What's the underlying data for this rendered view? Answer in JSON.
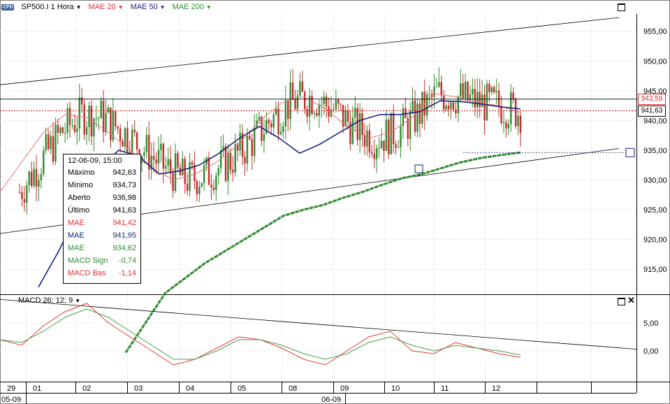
{
  "toolbar": {
    "badge": "CFD",
    "symbol": "SP500.I 1 Hora",
    "indicators": [
      {
        "label": "MAE 20",
        "color": "#e03030"
      },
      {
        "label": "MAE 50",
        "color": "#1a237e"
      },
      {
        "label": "MAE 200",
        "color": "#2e8b2e"
      }
    ]
  },
  "macd_panel": {
    "label": "MACD 26; 12; 9"
  },
  "info_box": {
    "timestamp": "12-06-09, 15:00",
    "rows": [
      {
        "label": "Máximo",
        "value": "942,63",
        "color": "#000000"
      },
      {
        "label": "Mínimo",
        "value": "934,73",
        "color": "#000000"
      },
      {
        "label": "Aberto",
        "value": "936,98",
        "color": "#000000"
      },
      {
        "label": "Último",
        "value": "941,63",
        "color": "#000000"
      },
      {
        "label": "MAE",
        "value": "941,42",
        "color": "#e03030"
      },
      {
        "label": "MAE",
        "value": "941,95",
        "color": "#1a237e"
      },
      {
        "label": "MAE",
        "value": "934,62",
        "color": "#2e8b2e"
      },
      {
        "label": "MACD Sign",
        "value": "-0,74",
        "color": "#2e8b2e"
      },
      {
        "label": "MACD Bas",
        "value": "-1,14",
        "color": "#e03030"
      }
    ]
  },
  "price_tags": [
    {
      "value": "943,59",
      "color": "#d32f2f"
    },
    {
      "value": "941,63",
      "color": "#000000"
    }
  ],
  "colors": {
    "candle_up": "#2e8b2e",
    "candle_down": "#c62828",
    "ma20": "#e57373",
    "ma50": "#1a237e",
    "ma200": "#2e8b2e",
    "macd_line": "#e53935",
    "signal_line": "#43a047",
    "grid": "#d0d0d0",
    "last_price_line": "#d32f2f"
  },
  "chart_data": [
    {
      "type": "candlestick",
      "title": "SP500.I 1 Hora",
      "y_axis_side": "right",
      "y_ticks": [
        "955,00",
        "950,00",
        "945,00",
        "940,00",
        "935,00",
        "930,00",
        "925,00",
        "920,00",
        "915,00"
      ],
      "y_values": [
        955,
        950,
        945,
        940,
        935,
        930,
        925,
        920,
        915
      ],
      "ylim": [
        910.8,
        957.9
      ],
      "x_ticks": [
        "29",
        "01",
        "02",
        "03",
        "04",
        "05",
        "08",
        "09",
        "10",
        "11",
        "12"
      ],
      "x_group_labels": [
        "05-09",
        "06-09"
      ],
      "last_price": 941.63,
      "last_close_line": 943.59,
      "series": [
        {
          "name": "MAE 20",
          "values": [
            928,
            933,
            938,
            941,
            940.5,
            938,
            935,
            932,
            930,
            931,
            933,
            936,
            940,
            943,
            944,
            942,
            939,
            937,
            938,
            940.5,
            944.5,
            944,
            943,
            942.5,
            941.4
          ]
        },
        {
          "name": "MAE 50",
          "values": [
            912,
            918,
            925,
            932,
            935,
            934,
            931,
            931.5,
            932.5,
            934.5,
            937,
            939,
            937,
            934.5,
            936,
            938,
            940,
            941,
            941,
            941.5,
            943.3,
            943.2,
            942.8,
            942.3,
            941.95
          ]
        },
        {
          "name": "MAE 200",
          "values": [
            901,
            906,
            911,
            913.5,
            916,
            918,
            920,
            922,
            924,
            925,
            925.8,
            927,
            928,
            929.2,
            930.3,
            931,
            932,
            933,
            933.7,
            934.2,
            934.62
          ]
        }
      ],
      "trendlines": [
        {
          "from": [
            0,
            946
          ],
          "to": [
            24,
            957.3
          ]
        },
        {
          "from": [
            0,
            921
          ],
          "to": [
            24,
            935.3
          ]
        }
      ]
    },
    {
      "type": "line",
      "title": "MACD 26; 12; 9",
      "y_ticks": [
        "5,00",
        "0,00"
      ],
      "y_values": [
        5,
        0
      ],
      "ylim": [
        -5.5,
        10
      ],
      "series": [
        {
          "name": "MACD Bas",
          "values": [
            2,
            1,
            4.5,
            7,
            8.5,
            5,
            2.5,
            0,
            -2.5,
            -1.5,
            0.5,
            2.5,
            2,
            0.5,
            -1.5,
            -2.5,
            0,
            2.5,
            3.5,
            0,
            -0.5,
            1.5,
            0.5,
            -0.5,
            -1.14
          ]
        },
        {
          "name": "MACD Sign",
          "values": [
            2,
            1.5,
            3.5,
            6,
            7.5,
            6,
            3.5,
            1,
            -1.5,
            -1.5,
            0,
            2,
            2,
            1,
            -0.5,
            -1.5,
            -0.5,
            1.5,
            2.5,
            1,
            0,
            1,
            0.5,
            0,
            -0.74
          ]
        }
      ]
    }
  ]
}
